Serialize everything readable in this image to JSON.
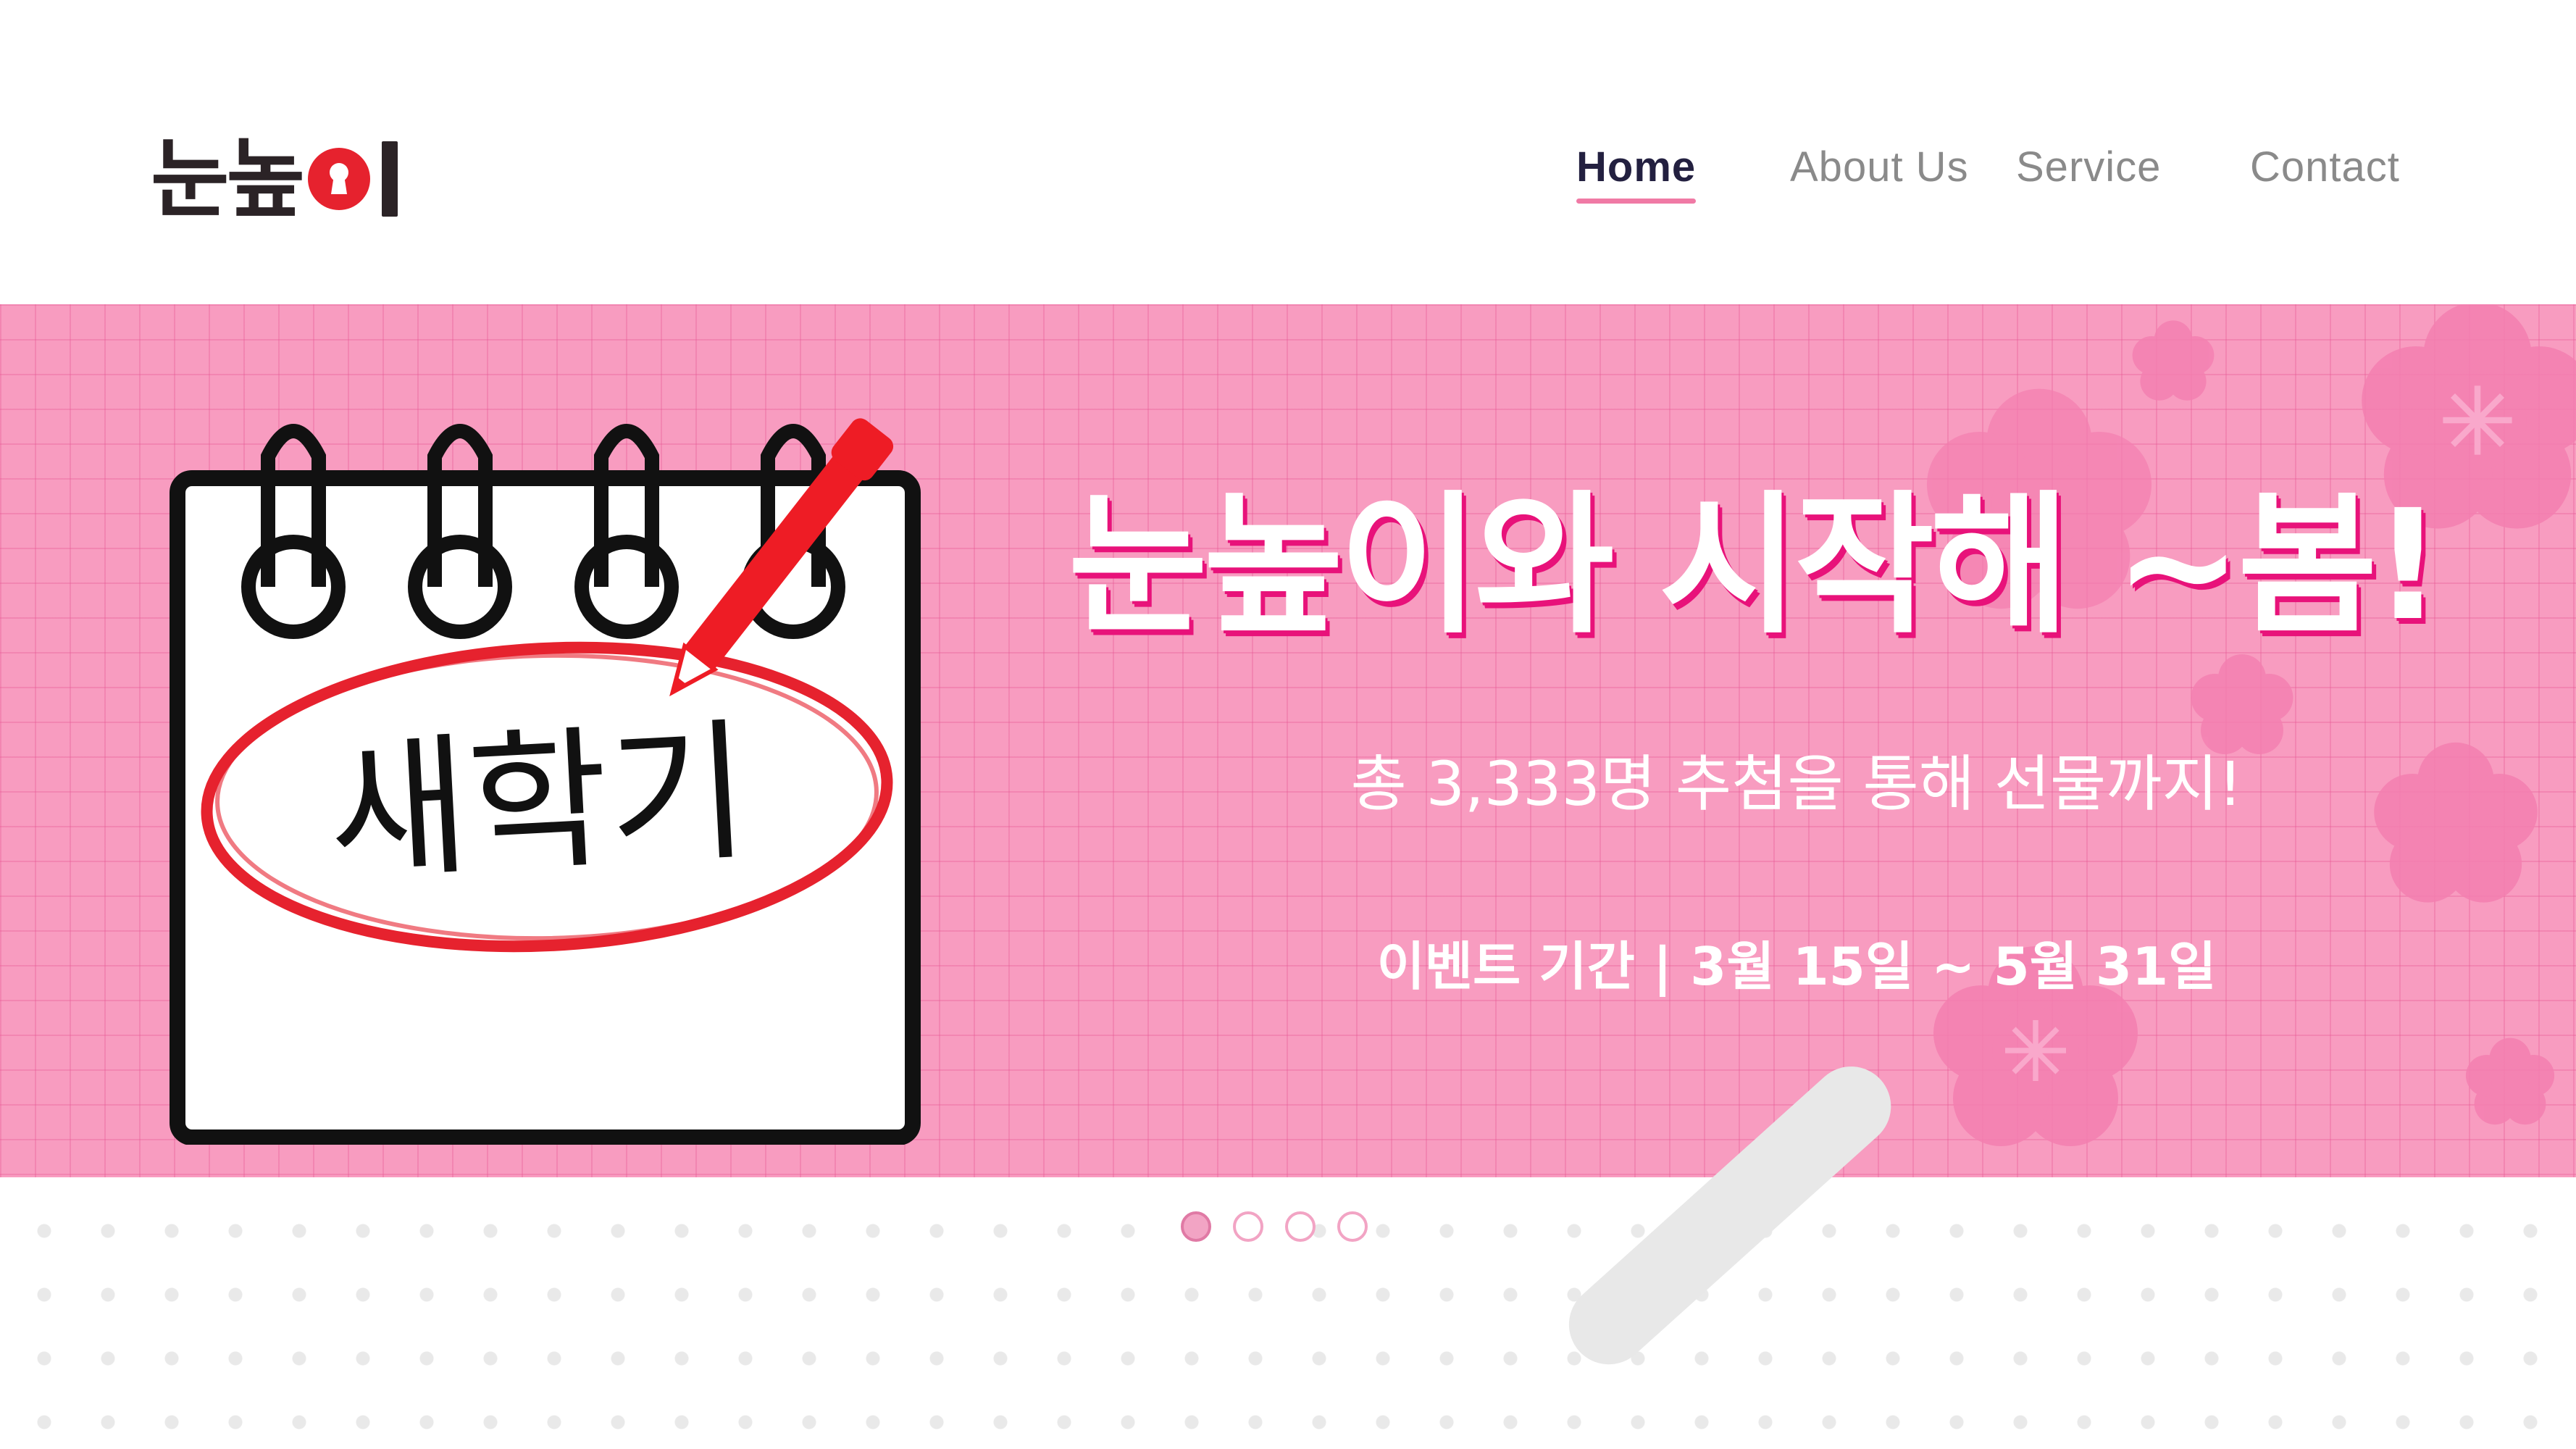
{
  "header": {
    "logo": {
      "text_left": "눈높",
      "text_right": "",
      "icon": "keyhole-icon"
    },
    "nav": [
      {
        "label": "Home",
        "active": true
      },
      {
        "label": "About Us",
        "active": false
      },
      {
        "label": "Service",
        "active": false
      },
      {
        "label": "Contact",
        "active": false
      }
    ]
  },
  "banner": {
    "notepad_text": "새학기",
    "title": "눈높이와 시작해 ~봄!",
    "subtitle": "총 3,333명 추첨을 통해 선물까지!",
    "period": "이벤트 기간 | 3월 15일 ~ 5월 31일"
  },
  "pagination": {
    "count": 4,
    "active_index": 0
  },
  "colors": {
    "accent": "#e8127a",
    "banner_bg": "#f89cc0",
    "nav_active": "#232040",
    "nav_inactive": "#8a8a8a",
    "logo_red": "#e6222e"
  }
}
